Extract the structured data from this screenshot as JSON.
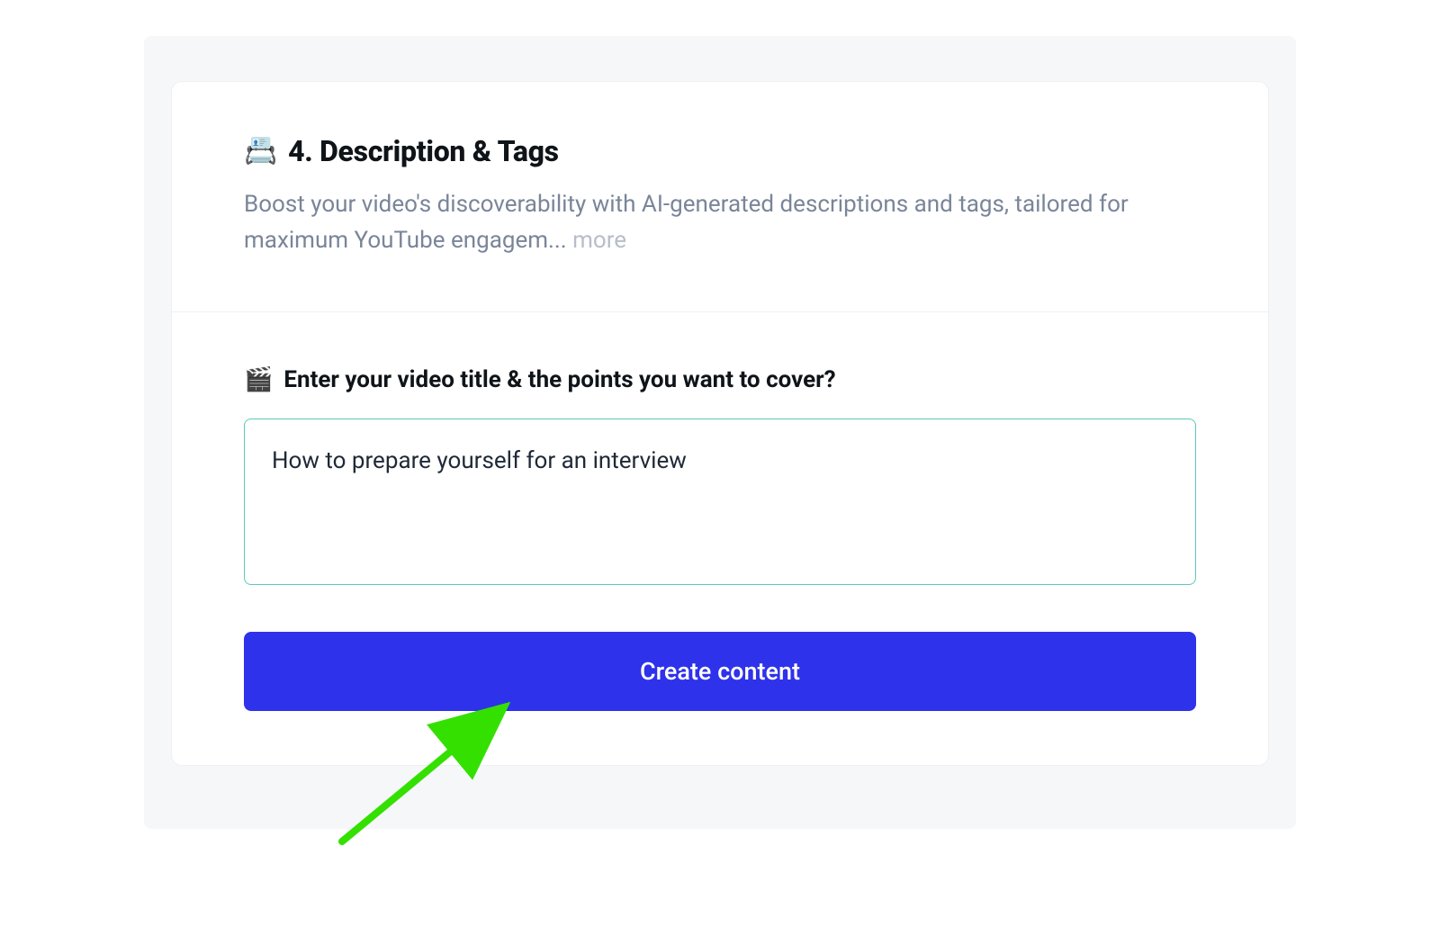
{
  "section": {
    "title_icon": "📇",
    "title": "4. Description & Tags",
    "subtitle_text": "Boost your video's discoverability with AI-generated descriptions and tags, tailored for maximum YouTube engagem... ",
    "more_label": "more"
  },
  "input": {
    "label_icon": "🎬",
    "label": "Enter your video title & the points you want to cover?",
    "value": "How to prepare yourself for an interview"
  },
  "actions": {
    "create_label": "Create content"
  },
  "colors": {
    "primary": "#2e32ea",
    "input_border": "#5ac9b9",
    "arrow": "#34e000"
  }
}
